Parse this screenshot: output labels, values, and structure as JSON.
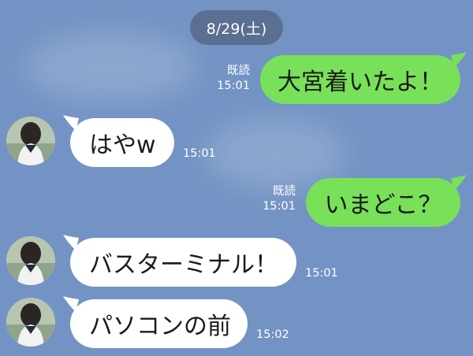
{
  "date_separator": "8/29(土)",
  "colors": {
    "background": "#7393c4",
    "outgoing": "#79e05a",
    "incoming": "#ffffff",
    "date_pill": "#5b6f92"
  },
  "messages": [
    {
      "direction": "outgoing",
      "text": "大宮着いたよ！",
      "read_label": "既読",
      "time": "15:01"
    },
    {
      "direction": "incoming",
      "text": "はやw",
      "time": "15:01",
      "avatar": "avatar-icon"
    },
    {
      "direction": "outgoing",
      "text": "いまどこ？",
      "read_label": "既読",
      "time": "15:01"
    },
    {
      "direction": "incoming",
      "text": "バスターミナル！",
      "time": "15:01",
      "avatar": "avatar-icon"
    },
    {
      "direction": "incoming",
      "text": "パソコンの前",
      "time": "15:02",
      "avatar": "avatar-icon"
    }
  ]
}
